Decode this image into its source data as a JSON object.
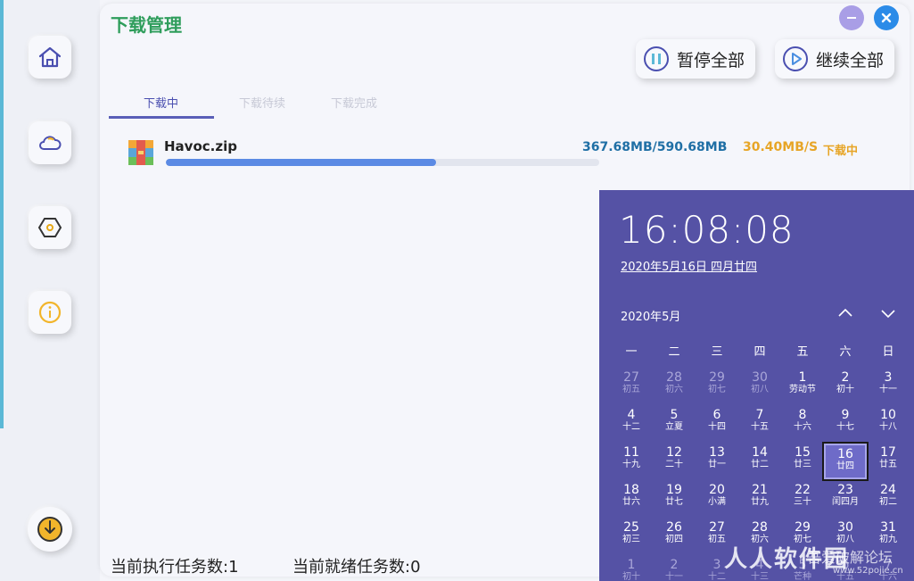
{
  "app": {
    "title": "下载管理"
  },
  "colors": {
    "accent": "#5a5fb8",
    "title_green": "#2e9d5b",
    "size_blue": "#1f6fa5",
    "speed_orange": "#e7a526",
    "calendar_bg": "#5552a5",
    "progress": "#5b8ae4"
  },
  "sidebar": {
    "items": [
      {
        "name": "home-icon"
      },
      {
        "name": "cloud-icon"
      },
      {
        "name": "settings-hex-icon"
      },
      {
        "name": "info-icon"
      },
      {
        "name": "download-icon"
      }
    ]
  },
  "window_controls": {
    "minimize": "minimize-icon",
    "close": "close-icon"
  },
  "toolbar": {
    "pause_all": "暂停全部",
    "resume_all": "继续全部"
  },
  "tabs": [
    {
      "label": "下载中",
      "active": true
    },
    {
      "label": "下载待续",
      "active": false
    },
    {
      "label": "下载完成",
      "active": false
    }
  ],
  "downloads": [
    {
      "file_name": "Havoc.zip",
      "size": "367.68MB/590.68MB",
      "speed": "30.40MB/S",
      "status": "下载中",
      "progress": 0.6225
    }
  ],
  "footer": {
    "running": "当前执行任务数:1",
    "ready": "当前就绪任务数:0"
  },
  "calendar": {
    "time": "16:08:08",
    "full_date": "2020年5月16日 四月廿四",
    "month_label": "2020年5月",
    "weekdays": [
      "一",
      "二",
      "三",
      "四",
      "五",
      "六",
      "日"
    ],
    "weeks": [
      [
        [
          "27",
          "初五",
          1
        ],
        [
          "28",
          "初六",
          1
        ],
        [
          "29",
          "初七",
          1
        ],
        [
          "30",
          "初八",
          1
        ],
        [
          "1",
          "劳动节",
          0
        ],
        [
          "2",
          "初十",
          0
        ],
        [
          "3",
          "十一",
          0
        ]
      ],
      [
        [
          "4",
          "十二",
          0
        ],
        [
          "5",
          "立夏",
          0
        ],
        [
          "6",
          "十四",
          0
        ],
        [
          "7",
          "十五",
          0
        ],
        [
          "8",
          "十六",
          0
        ],
        [
          "9",
          "十七",
          0
        ],
        [
          "10",
          "十八",
          0
        ]
      ],
      [
        [
          "11",
          "十九",
          0
        ],
        [
          "12",
          "二十",
          0
        ],
        [
          "13",
          "廿一",
          0
        ],
        [
          "14",
          "廿二",
          0
        ],
        [
          "15",
          "廿三",
          0
        ],
        [
          "16",
          "廿四",
          2
        ],
        [
          "17",
          "廿五",
          0
        ]
      ],
      [
        [
          "18",
          "廿六",
          0
        ],
        [
          "19",
          "廿七",
          0
        ],
        [
          "20",
          "小满",
          0
        ],
        [
          "21",
          "廿九",
          0
        ],
        [
          "22",
          "三十",
          0
        ],
        [
          "23",
          "闰四月",
          0
        ],
        [
          "24",
          "初二",
          0
        ]
      ],
      [
        [
          "25",
          "初三",
          0
        ],
        [
          "26",
          "初四",
          0
        ],
        [
          "27",
          "初五",
          0
        ],
        [
          "28",
          "初六",
          0
        ],
        [
          "29",
          "初七",
          0
        ],
        [
          "30",
          "初八",
          0
        ],
        [
          "31",
          "初九",
          0
        ]
      ],
      [
        [
          "1",
          "初十",
          1
        ],
        [
          "2",
          "十一",
          1
        ],
        [
          "3",
          "十二",
          1
        ],
        [
          "4",
          "十三",
          1
        ],
        [
          "5",
          "芒种",
          1
        ],
        [
          "6",
          "十五",
          1
        ],
        [
          "7",
          "十六",
          1
        ]
      ]
    ]
  },
  "watermark": {
    "main": "人人软件园",
    "sub": "吾爱破解论坛",
    "url": "www.52pojie.cn"
  }
}
